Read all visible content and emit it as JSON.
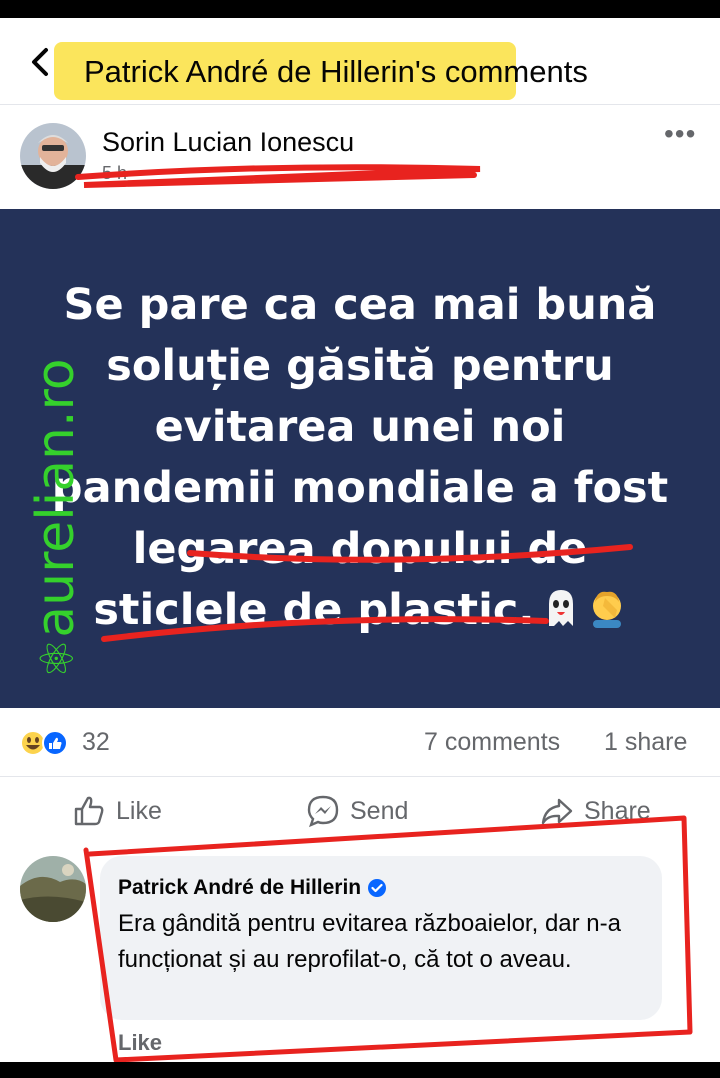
{
  "header": {
    "title": "Patrick André de Hillerin's comments"
  },
  "post": {
    "author": "Sorin Lucian Ionescu",
    "time": "5 h",
    "image_text_plain": "Se pare ca cea mai bună soluție găsită pentru evitarea unei noi pandemii mondiale a",
    "image_text_underlined_1": "fost legarea dopului de",
    "image_text_underlined_2": "sticlele de plastic.",
    "watermark": "aurelian.ro"
  },
  "stats": {
    "reactions": "32",
    "comments": "7 comments",
    "shares": "1 share"
  },
  "actions": {
    "like": "Like",
    "send": "Send",
    "share": "Share"
  },
  "comment": {
    "author": "Patrick André de Hillerin",
    "text": "Era gândită pentru evitarea războaielor, dar n-a funcționat și au reprofilat-o, că tot o aveau.",
    "like": "Like"
  },
  "colors": {
    "image_bg": "#243259",
    "watermark": "#35d12c",
    "highlight": "#fbe24a",
    "annotation_red": "#e8231f",
    "facebook_blue": "#0866ff"
  }
}
